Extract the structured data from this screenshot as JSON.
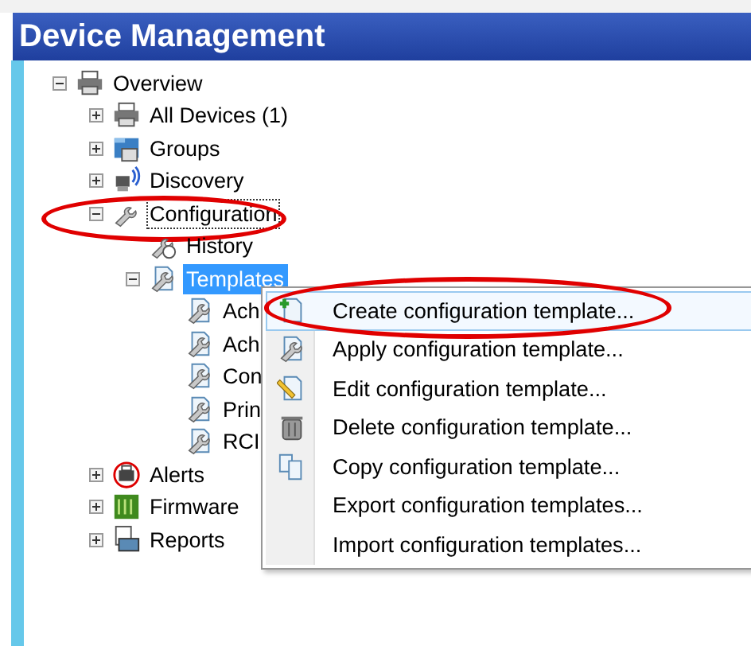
{
  "panel": {
    "title": "Device Management"
  },
  "tree": [
    {
      "label": "Overview",
      "kind": "printer",
      "expanded": true,
      "selected": false,
      "focused": false,
      "highlight": false,
      "children": [
        {
          "label": "All Devices (1)",
          "kind": "printer",
          "expanded": false,
          "selected": false,
          "focused": false,
          "highlight": false
        },
        {
          "label": "Groups",
          "kind": "groups",
          "expanded": false,
          "selected": false,
          "focused": false,
          "highlight": false
        },
        {
          "label": "Discovery",
          "kind": "discovery",
          "expanded": false,
          "selected": false,
          "focused": false,
          "highlight": false
        },
        {
          "label": "Configuration",
          "kind": "wrench",
          "expanded": true,
          "selected": false,
          "focused": true,
          "highlight": true,
          "children": [
            {
              "label": "History",
              "kind": "history",
              "selected": false,
              "focused": false,
              "highlight": false
            },
            {
              "label": "Templates",
              "kind": "template",
              "expanded": true,
              "selected": true,
              "focused": false,
              "highlight": false,
              "children": [
                {
                  "label": "Ach",
                  "kind": "template",
                  "selected": false,
                  "focused": false,
                  "highlight": false
                },
                {
                  "label": "Ach",
                  "kind": "template",
                  "selected": false,
                  "focused": false,
                  "highlight": false
                },
                {
                  "label": "Con",
                  "kind": "template",
                  "selected": false,
                  "focused": false,
                  "highlight": false
                },
                {
                  "label": "Prin",
                  "kind": "template",
                  "selected": false,
                  "focused": false,
                  "highlight": false
                },
                {
                  "label": "RCI",
                  "kind": "template",
                  "selected": false,
                  "focused": false,
                  "highlight": false
                }
              ]
            }
          ]
        },
        {
          "label": "Alerts",
          "kind": "alerts",
          "expanded": false,
          "selected": false,
          "focused": false,
          "highlight": false
        },
        {
          "label": "Firmware",
          "kind": "firmware",
          "expanded": false,
          "selected": false,
          "focused": false,
          "highlight": false
        },
        {
          "label": "Reports",
          "kind": "reports",
          "expanded": false,
          "selected": false,
          "focused": false,
          "highlight": false
        }
      ]
    }
  ],
  "context_menu": {
    "items": [
      {
        "label": "Create configuration template...",
        "kind": "create",
        "selected": true,
        "highlight": true
      },
      {
        "label": "Apply configuration template...",
        "kind": "apply",
        "selected": false,
        "highlight": false
      },
      {
        "label": "Edit configuration template...",
        "kind": "edit",
        "selected": false,
        "highlight": false
      },
      {
        "label": "Delete configuration template...",
        "kind": "delete",
        "selected": false,
        "highlight": false
      },
      {
        "label": "Copy configuration template...",
        "kind": "copy",
        "selected": false,
        "highlight": false
      },
      {
        "label": "Export configuration templates...",
        "kind": "plain",
        "selected": false,
        "highlight": false
      },
      {
        "label": "Import configuration templates...",
        "kind": "plain",
        "selected": false,
        "highlight": false
      }
    ]
  }
}
